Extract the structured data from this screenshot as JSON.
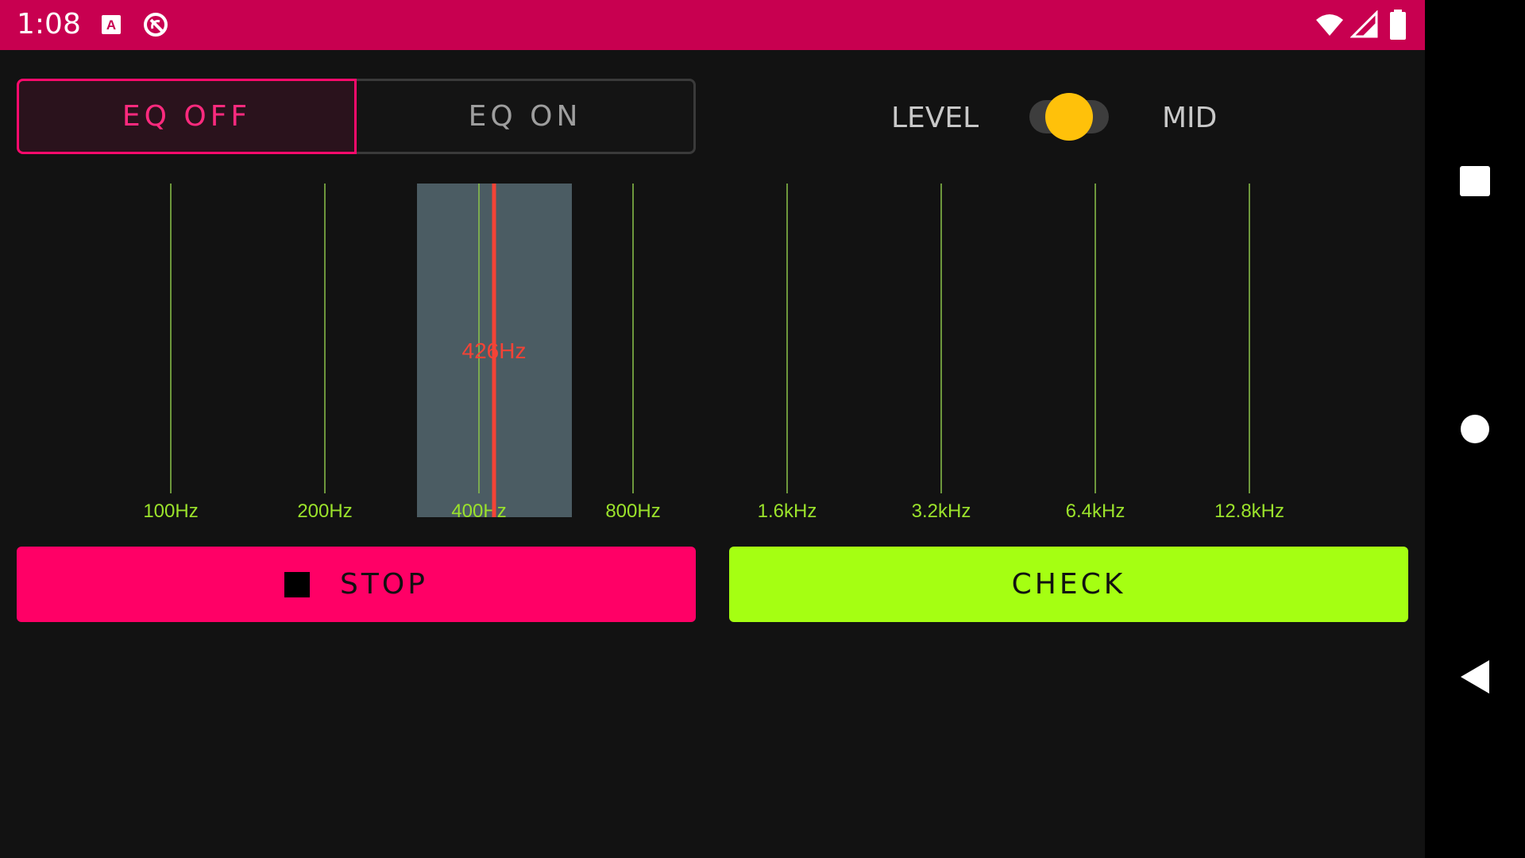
{
  "status_bar": {
    "time": "1:08",
    "icons": [
      "a-notification-icon",
      "q-notification-icon",
      "wifi-icon",
      "signal-icon",
      "battery-icon"
    ],
    "color": "#c80050"
  },
  "eq_toggle": {
    "off_label": "EQ OFF",
    "on_label": "EQ ON",
    "selected": "EQ OFF"
  },
  "level_switch": {
    "left_label": "LEVEL",
    "right_label": "MID",
    "state": "MID"
  },
  "eq_chart": {
    "bands": [
      "100Hz",
      "200Hz",
      "400Hz",
      "800Hz",
      "1.6kHz",
      "3.2kHz",
      "6.4kHz",
      "12.8kHz"
    ],
    "selected_band": "400Hz",
    "marker_label": "426Hz",
    "band_line_color": "#8bc34a",
    "marker_color": "#f44336",
    "highlight_color": "#4b5c63"
  },
  "buttons": {
    "stop_label": "STOP",
    "check_label": "CHECK",
    "stop_color": "#ff0066",
    "check_color": "#a5ff12"
  },
  "nav_bar": {
    "icons": [
      "recents-icon",
      "home-icon",
      "back-icon"
    ]
  }
}
